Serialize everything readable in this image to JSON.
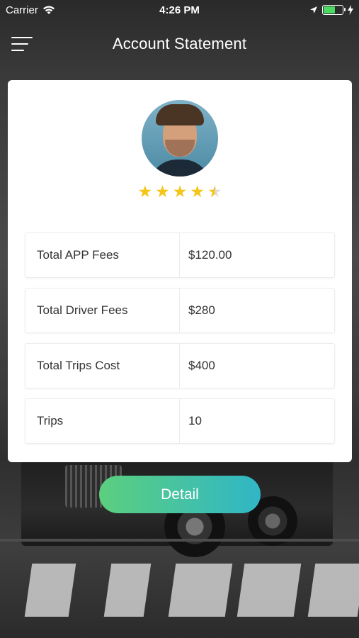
{
  "status_bar": {
    "carrier": "Carrier",
    "time": "4:26 PM",
    "battery_level": 0.6
  },
  "nav": {
    "title": "Account Statement",
    "menu_icon": "hamburger-menu-icon"
  },
  "profile": {
    "rating": 4.5,
    "rating_max": 5
  },
  "stats": [
    {
      "label": "Total APP Fees",
      "value": "$120.00"
    },
    {
      "label": "Total Driver Fees",
      "value": "$280"
    },
    {
      "label": "Total Trips Cost",
      "value": "$400"
    },
    {
      "label": "Trips",
      "value": "10"
    }
  ],
  "detail_button": {
    "label": "Detail"
  },
  "colors": {
    "button_gradient_start": "#5ccf7e",
    "button_gradient_end": "#30b6c6",
    "star": "#f5c518",
    "battery": "#4cd964"
  }
}
